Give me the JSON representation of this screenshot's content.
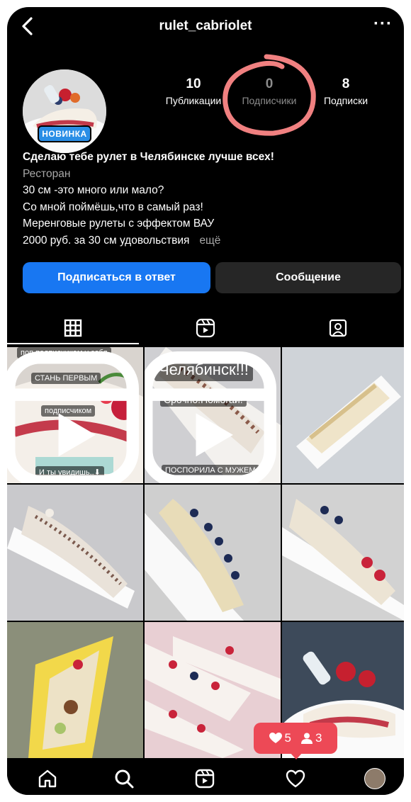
{
  "header": {
    "username": "rulet_cabriolet",
    "more_label": "···"
  },
  "profile": {
    "badge": "НОВИНКА",
    "stats": {
      "posts_count": "10",
      "posts_label": "Публикации",
      "followers_count": "0",
      "followers_label": "Подписчики",
      "following_count": "8",
      "following_label": "Подписки"
    },
    "bio": {
      "name": "Сделаю тебе рулет в Челябинске лучше всех!",
      "category": "Ресторан",
      "line1": "30 см -это много или мало?",
      "line2": "Со мной поймёшь,что в самый раз!",
      "line3": "Меренговые рулеты с эффектом ВАУ",
      "line4": "2000 руб. за 30 см удовольствия",
      "more": "ещё"
    }
  },
  "actions": {
    "follow_back": "Подписаться в ответ",
    "message": "Сообщение"
  },
  "tabs": [
    "grid-icon",
    "reels-icon",
    "tagged-icon"
  ],
  "grid": {
    "post1": {
      "top_text": "поп подписчикам у себя",
      "cap1": "СТАНЬ ПЕРВЫМ",
      "cap2": "подписчиком",
      "cap3": "И ты увидишь..⬇"
    },
    "post2": {
      "cap1": "Челябинск!!!",
      "cap2": "Срочно!Помогай!",
      "cap3": "ПОСПОРИЛА С МУЖЕМ"
    }
  },
  "notification": {
    "likes": "5",
    "follows": "3",
    "color": "#ed4956"
  },
  "bottom_nav": [
    "home-icon",
    "search-icon",
    "reels-icon",
    "activity-heart-icon",
    "profile-avatar"
  ],
  "colors": {
    "accent": "#1877f2",
    "badge": "#2a8ee6",
    "annotation": "#f08080"
  }
}
